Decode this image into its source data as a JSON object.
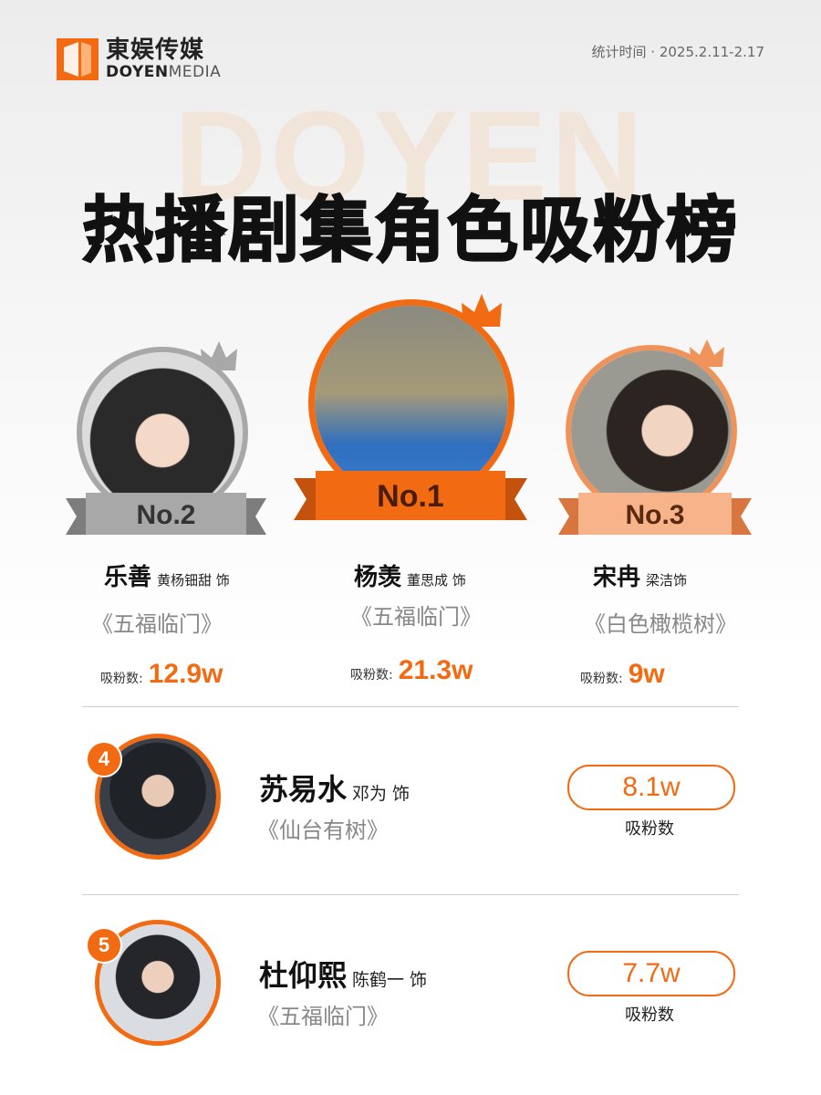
{
  "header": {
    "logo_cn": "東娱传媒",
    "logo_en_bold": "DOYEN",
    "logo_en_light": "MEDIA",
    "date": "统计时间 · 2025.2.11-2.17"
  },
  "watermark": "DOYEN",
  "title": "热播剧集角色吸粉榜",
  "fans_label": "吸粉数:",
  "podium": [
    {
      "rank": "No.2",
      "name": "乐善",
      "actor": "黄杨钿甜 饰",
      "show": "《五福临门》",
      "fans": "12.9w"
    },
    {
      "rank": "No.1",
      "name": "杨羡",
      "actor": "董思成 饰",
      "show": "《五福临门》",
      "fans": "21.3w"
    },
    {
      "rank": "No.3",
      "name": "宋冉",
      "actor": "梁洁饰",
      "show": "《白色橄榄树》",
      "fans": "9w"
    }
  ],
  "list": [
    {
      "rank": "4",
      "name": "苏易水",
      "actor": "邓为 饰",
      "show": "《仙台有树》",
      "fans": "8.1w",
      "fans_label": "吸粉数"
    },
    {
      "rank": "5",
      "name": "杜仰熙",
      "actor": "陈鹤一 饰",
      "show": "《五福临门》",
      "fans": "7.7w",
      "fans_label": "吸粉数"
    }
  ],
  "colors": {
    "accent": "#f26a12",
    "silver": "#a8a8a8",
    "bronze": "#f0935a"
  }
}
